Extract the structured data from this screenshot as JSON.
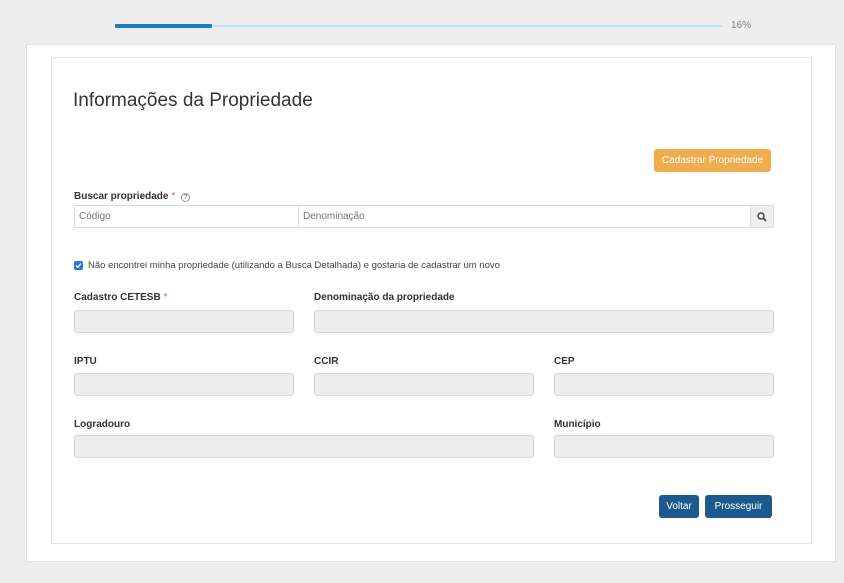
{
  "progress": {
    "percent_label": "16%",
    "fraction": 0.16
  },
  "page_title": "Informações da Propriedade",
  "register_button": "Cadastrar Propriedade",
  "search": {
    "label": "Buscar propriedade",
    "required_mark": "*",
    "help_icon": "question-circle-icon",
    "code_placeholder": "Código",
    "denomination_placeholder": "Denominação",
    "search_icon": "magnifier-icon"
  },
  "not_found_checkbox": {
    "checked": true,
    "label": "Não encontrei minha propriedade (utilizando a Busca Detalhada) e gostaria de cadastrar um novo"
  },
  "fields": {
    "cadastro_cetesb": {
      "label": "Cadastro CETESB",
      "required_mark": "*",
      "value": ""
    },
    "denominacao": {
      "label": "Denominação da propriedade",
      "value": ""
    },
    "iptu": {
      "label": "IPTU",
      "value": ""
    },
    "ccir": {
      "label": "CCIR",
      "value": ""
    },
    "cep": {
      "label": "CEP",
      "value": ""
    },
    "logradouro": {
      "label": "Logradouro",
      "value": ""
    },
    "municipio": {
      "label": "Município",
      "value": ""
    }
  },
  "actions": {
    "back": "Voltar",
    "next": "Prosseguir"
  },
  "colors": {
    "primary": "#1c5a8e",
    "warning": "#f0ad4e",
    "progress_fill": "#1e7fc0",
    "progress_track": "#bfe6f5",
    "required": "#e05a5a"
  }
}
